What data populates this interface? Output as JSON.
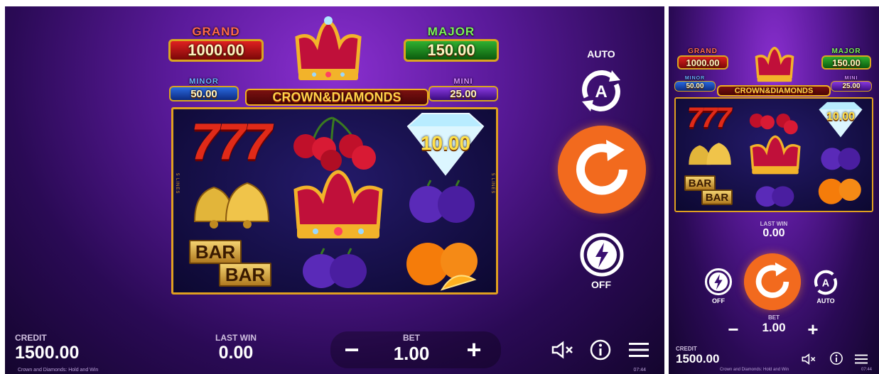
{
  "jackpots": {
    "grand": {
      "label": "GRAND",
      "value": "1000.00"
    },
    "major": {
      "label": "MAJOR",
      "value": "150.00"
    },
    "minor": {
      "label": "MINOR",
      "value": "50.00"
    },
    "mini": {
      "label": "MINI",
      "value": "25.00"
    }
  },
  "logo_text": "CROWN&DIAMONDS",
  "reel_side_text": "5 LINES",
  "diamond_value": "10.00",
  "symbols": {
    "bar_top": "BAR",
    "bar_bottom": "BAR",
    "seven": "777"
  },
  "controls": {
    "auto_label": "AUTO",
    "turbo_label": "OFF",
    "minus": "−",
    "plus": "+"
  },
  "hud": {
    "credit_label": "CREDIT",
    "credit_value": "1500.00",
    "last_win_label": "LAST WIN",
    "last_win_value": "0.00",
    "bet_label": "BET",
    "bet_value": "1.00"
  },
  "footer": {
    "game_title": "Crown and Diamonds: Hold and Win",
    "time": "07:44"
  },
  "colors": {
    "spin": "#f26a1e",
    "frame": "#e0a020",
    "background": "#5a1a9a"
  }
}
